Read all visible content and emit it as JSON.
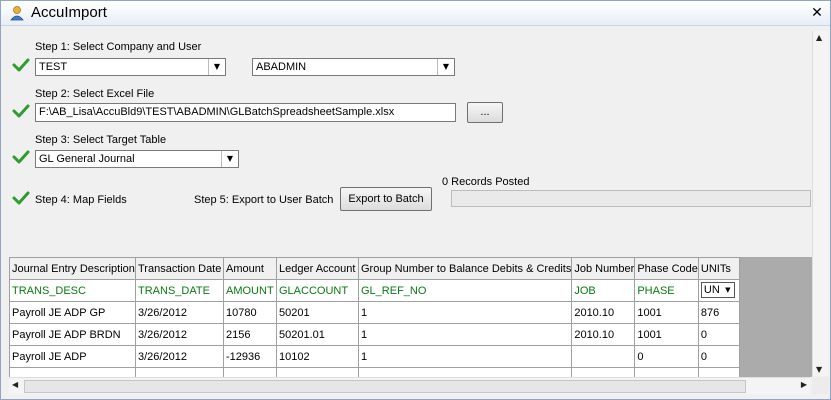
{
  "window": {
    "title": "AccuImport",
    "close_glyph": "✕"
  },
  "step1": {
    "label": "Step 1:  Select  Company and User",
    "company": "TEST",
    "user": "ABADMIN"
  },
  "step2": {
    "label": "Step 2:  Select Excel File",
    "file_path": "F:\\AB_Lisa\\AccuBld9\\TEST\\ABADMIN\\GLBatchSpreadsheetSample.xlsx",
    "browse_label": "..."
  },
  "step3": {
    "label": "Step 3:  Select Target Table",
    "table": "GL General Journal"
  },
  "step4": {
    "label": "Step 4:  Map Fields"
  },
  "step5": {
    "label": "Step 5:  Export to User Batch",
    "button_label": "Export to Batch",
    "records_posted": "0 Records Posted"
  },
  "grid": {
    "headers": [
      "Journal Entry Description",
      "Transaction Date",
      "Amount",
      "Ledger Account",
      "Group Number to Balance Debits & Credits",
      "Job Number",
      "Phase Code",
      "UNITs"
    ],
    "field_map": [
      "TRANS_DESC",
      "TRANS_DATE",
      "AMOUNT",
      "GLACCOUNT",
      "GL_REF_NO",
      "JOB",
      "PHASE",
      "UN"
    ],
    "rows": [
      [
        "Payroll JE ADP GP",
        "3/26/2012",
        "10780",
        "50201",
        "1",
        "2010.10",
        "1001",
        "876"
      ],
      [
        "Payroll JE ADP BRDN",
        "3/26/2012",
        "2156",
        "50201.01",
        "1",
        "2010.10",
        "1001",
        "0"
      ],
      [
        "Payroll JE ADP",
        "3/26/2012",
        "-12936",
        "10102",
        "1",
        "",
        "0",
        "0"
      ]
    ]
  },
  "colors": {
    "check_green": "#2e9c2e",
    "field_green": "#0a7a12"
  },
  "icons": {
    "app": "user-icon",
    "check": "check-icon",
    "dropdown": "chevron-down-icon"
  }
}
